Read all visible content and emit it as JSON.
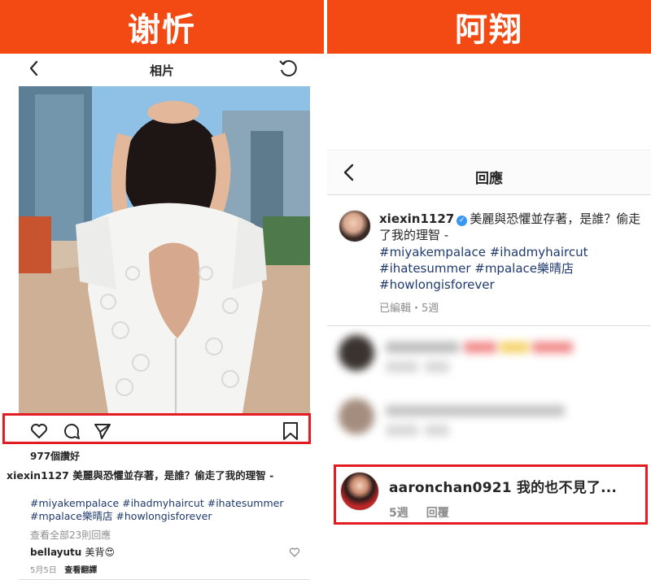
{
  "banners": {
    "left": "谢忻",
    "right": "阿翔"
  },
  "left": {
    "header_title": "相片",
    "likes": "977個讚好",
    "caption_user": "xiexin1127",
    "caption_text": "美麗與恐懼並存著，是誰？偷走了我的理智 -",
    "tags_line1": "#miyakempalace #ihadmyhaircut #ihatesummer",
    "tags_line2": "#mpalace樂晴店 #howlongisforever",
    "view_all": "查看全部23則回應",
    "comment_user": "bellayutu",
    "comment_text": "美背😍",
    "comment_date": "5月5日",
    "comment_translate": "查看翻譯"
  },
  "right": {
    "header_title": "回應",
    "caption_user": "xiexin1127",
    "verified_mark": "✓",
    "caption_text": "美麗與恐懼並存著，是誰？偷走了我的理智 -",
    "tags": [
      "#miyakempalace #ihadmyhaircut",
      "#ihatesummer #mpalace樂晴店",
      "#howlongisforever"
    ],
    "meta": "已編輯・5週",
    "highlight_user": "aaronchan0921",
    "highlight_text": "我的也不見了...",
    "highlight_time": "5週",
    "highlight_reply": "回覆"
  },
  "colors": {
    "banner": "#f24a12",
    "highlight_border": "#e31b23",
    "hashtag": "#1f3a6e",
    "verified": "#3897f0"
  }
}
